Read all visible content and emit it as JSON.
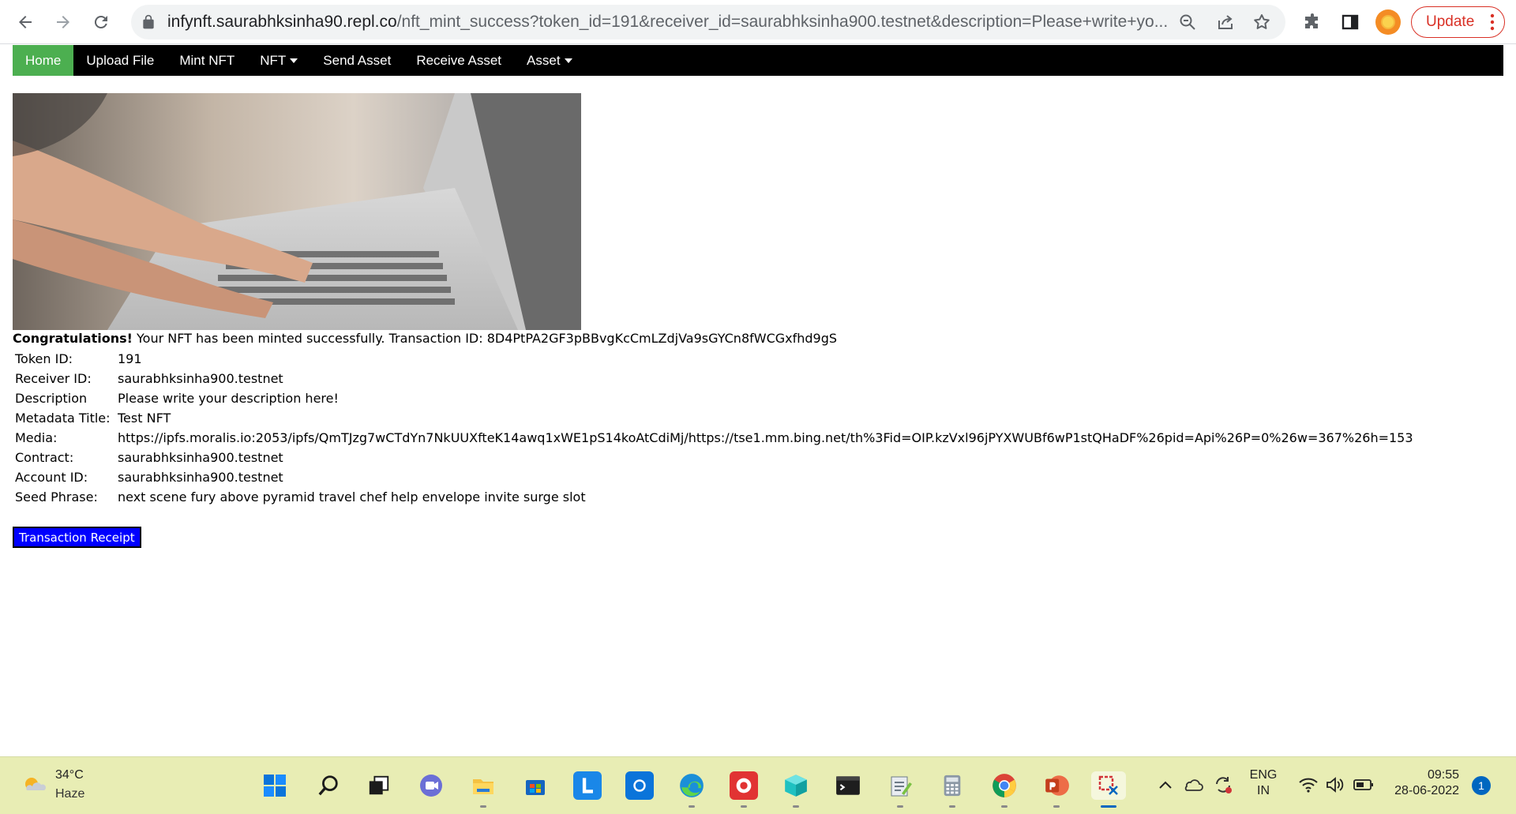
{
  "browser": {
    "url_host": "infynft.saurabhksinha90.repl.co",
    "url_path": "/nft_mint_success?token_id=191&receiver_id=saurabhksinha900.testnet&description=Please+write+yo...",
    "update_label": "Update",
    "icons": {
      "back": "back-arrow-icon",
      "forward": "forward-arrow-icon",
      "reload": "reload-icon",
      "lock": "lock-icon",
      "zoom": "zoom-icon",
      "share": "share-icon",
      "bookmark": "star-icon",
      "extensions": "puzzle-icon",
      "side_panel": "side-panel-icon",
      "menu": "kebab-menu-icon"
    }
  },
  "nav": {
    "items": [
      {
        "label": "Home",
        "active": true
      },
      {
        "label": "Upload File"
      },
      {
        "label": "Mint NFT"
      },
      {
        "label": "NFT",
        "dropdown": true
      },
      {
        "label": "Send Asset"
      },
      {
        "label": "Receive Asset"
      },
      {
        "label": "Asset",
        "dropdown": true
      }
    ],
    "active_color": "#4caf50"
  },
  "result": {
    "congrats_bold": "Congratulations!",
    "congrats_text": " Your NFT has been minted successfully. Transaction ID: 8D4PtPA2GF3pBBvgKcCmLZdjVa9sGYCn8fWCGxfhd9gS"
  },
  "details": [
    {
      "key": "Token ID:",
      "value": "191"
    },
    {
      "key": "Receiver ID:",
      "value": "saurabhksinha900.testnet"
    },
    {
      "key": "Description",
      "value": "Please write your description here!"
    },
    {
      "key": "Metadata Title:",
      "value": "Test NFT"
    },
    {
      "key": "Media:",
      "value": "https://ipfs.moralis.io:2053/ipfs/QmTJzg7wCTdYn7NkUUXfteK14awq1xWE1pS14koAtCdiMj/https://tse1.mm.bing.net/th%3Fid=OIP.kzVxl96jPYXWUBf6wP1stQHaDF%26pid=Api%26P=0%26w=367%26h=153"
    },
    {
      "key": "Contract:",
      "value": "saurabhksinha900.testnet"
    },
    {
      "key": "Account ID:",
      "value": "saurabhksinha900.testnet"
    },
    {
      "key": "Seed Phrase:",
      "value": "next scene fury above pyramid travel chef help envelope invite surge slot"
    }
  ],
  "receipt_button": "Transaction Receipt",
  "taskbar": {
    "weather_temp": "34°C",
    "weather_desc": "Haze",
    "lang_top": "ENG",
    "lang_bottom": "IN",
    "time": "09:55",
    "date": "28-06-2022",
    "notifications": "1",
    "apps": [
      "windows-start-icon",
      "search-icon",
      "task-view-icon",
      "teams-chat-icon",
      "file-explorer-icon",
      "microsoft-store-icon",
      "lens-app-icon",
      "outlook-icon",
      "edge-icon",
      "recorder-icon",
      "cube-3d-icon",
      "terminal-icon",
      "notepad-icon",
      "calculator-icon",
      "chrome-icon",
      "powerpoint-icon",
      "snipping-tool-icon"
    ]
  }
}
